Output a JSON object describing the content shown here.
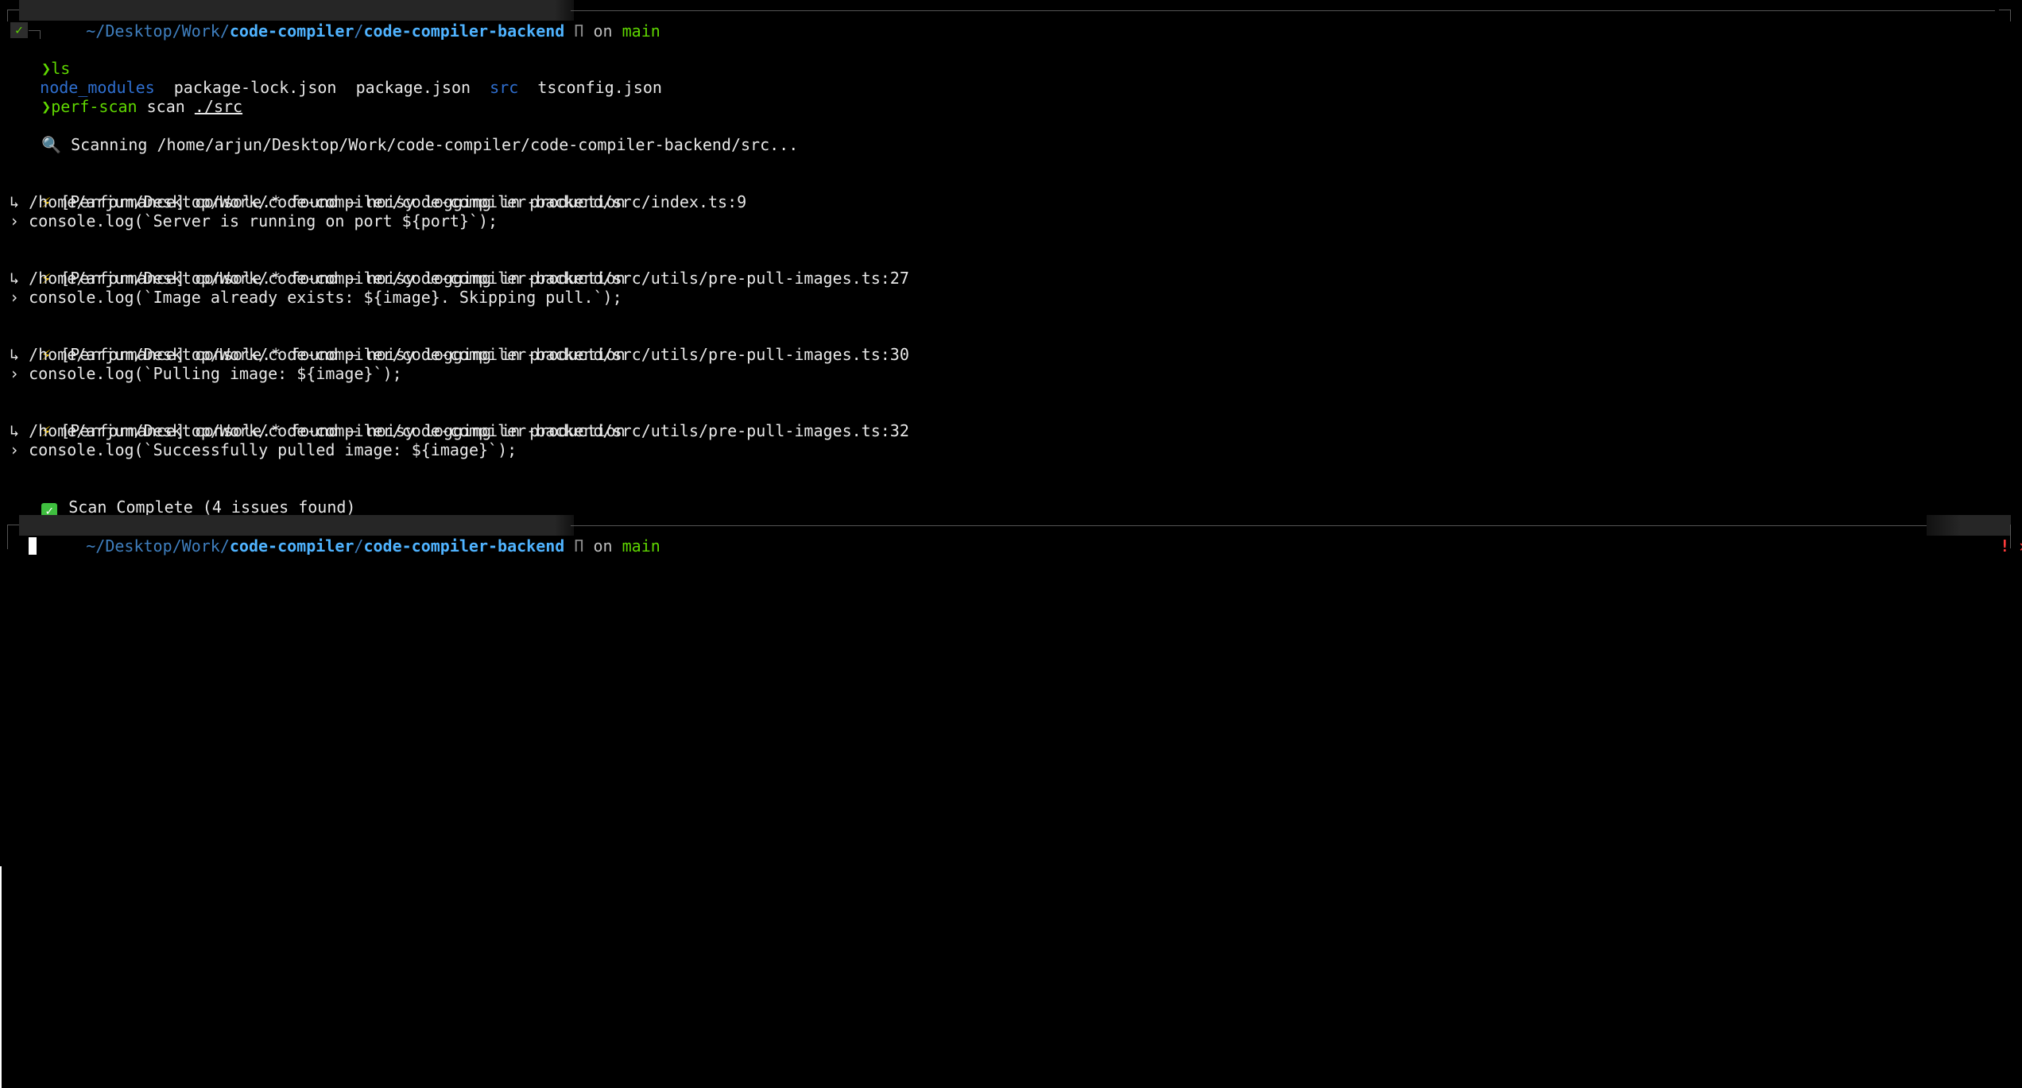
{
  "prompt": {
    "path_home": "~",
    "path_mid": "/Desktop/Work/",
    "path_parent": "code-compiler",
    "path_sep": "/",
    "path_current": "code-compiler-backend",
    "git_icon": "Π",
    "on_text": "on",
    "branch": "main",
    "success_mark": "✓",
    "error_mark": "! ✕"
  },
  "commands": {
    "ls": {
      "chevron": "❯",
      "command": "ls"
    },
    "scan": {
      "chevron": "❯",
      "command": "perf-scan",
      "subcommand": "scan",
      "argument": "./src"
    }
  },
  "ls_output": [
    {
      "name": "node_modules",
      "type": "dir"
    },
    {
      "name": "package-lock.json",
      "type": "file"
    },
    {
      "name": "package.json",
      "type": "file"
    },
    {
      "name": "src",
      "type": "dir"
    },
    {
      "name": "tsconfig.json",
      "type": "file"
    }
  ],
  "scan_output": {
    "scanning_icon": "🔍",
    "scanning_text": "Scanning /home/arjun/Desktop/Work/code-compiler/code-compiler-backend/src...",
    "issues": [
      {
        "icon": "⚡",
        "message": "[Performance] console.* found — noisy logging in production",
        "location": "↳ /home/arjun/Desktop/Work/code-compiler/code-compiler-backend/src/index.ts:9",
        "code": "› console.log(`Server is running on port ${port}`);"
      },
      {
        "icon": "⚡",
        "message": "[Performance] console.* found — noisy logging in production",
        "location": "↳ /home/arjun/Desktop/Work/code-compiler/code-compiler-backend/src/utils/pre-pull-images.ts:27",
        "code": "› console.log(`Image already exists: ${image}. Skipping pull.`);"
      },
      {
        "icon": "⚡",
        "message": "[Performance] console.* found — noisy logging in production",
        "location": "↳ /home/arjun/Desktop/Work/code-compiler/code-compiler-backend/src/utils/pre-pull-images.ts:30",
        "code": "› console.log(`Pulling image: ${image}`);"
      },
      {
        "icon": "⚡",
        "message": "[Performance] console.* found — noisy logging in production",
        "location": "↳ /home/arjun/Desktop/Work/code-compiler/code-compiler-backend/src/utils/pre-pull-images.ts:32",
        "code": "› console.log(`Successfully pulled image: ${image}`);"
      }
    ],
    "complete_icon": "✓",
    "complete_text": "Scan Complete (4 issues found)"
  },
  "colors": {
    "background": "#000000",
    "path_dim": "#3f7fbf",
    "path_bold": "#4fb3ff",
    "branch": "#5fd700",
    "chevron": "#5fd700",
    "dir": "#2f6fd0",
    "error": "#ff3b3b"
  }
}
